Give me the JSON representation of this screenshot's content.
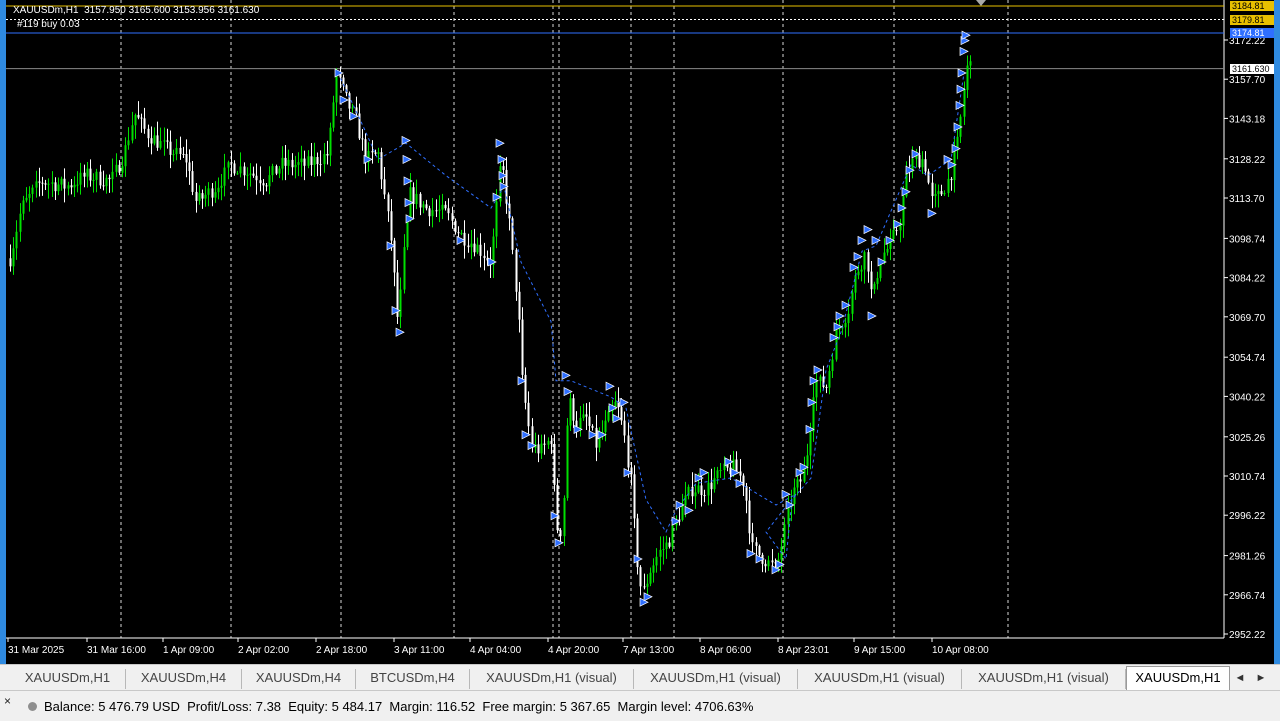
{
  "chart": {
    "header_line": "XAUUSDm,H1  3157.950 3165.600 3153.956 3161.630",
    "order_line": "#119 buy 0.03",
    "price_labels": [
      {
        "text": "3184.81",
        "price": 3184.81,
        "bg": "#e8c000",
        "fg": "#000000"
      },
      {
        "text": "3179.81",
        "price": 3179.81,
        "bg": "#e8c000",
        "fg": "#000000"
      },
      {
        "text": "3174.81",
        "price": 3174.81,
        "bg": "#2f6fff",
        "fg": "#ffffff"
      },
      {
        "text": "3161.630",
        "price": 3161.63,
        "bg": "#ffffff",
        "fg": "#000000"
      }
    ],
    "price_ticks": [
      "3172.22",
      "3157.70",
      "3143.18",
      "3128.22",
      "3113.70",
      "3098.74",
      "3084.22",
      "3069.70",
      "3054.74",
      "3040.22",
      "3025.26",
      "3010.74",
      "2996.22",
      "2981.26",
      "2966.74",
      "2952.22"
    ],
    "time_ticks": [
      "31 Mar 2025",
      "31 Mar 16:00",
      "1 Apr 09:00",
      "2 Apr 02:00",
      "2 Apr 18:00",
      "3 Apr 11:00",
      "4 Apr 04:00",
      "4 Apr 20:00",
      "7 Apr 13:00",
      "8 Apr 06:00",
      "8 Apr 23:01",
      "9 Apr 15:00",
      "10 Apr 08:00"
    ],
    "colors": {
      "background": "#000000",
      "bull": "#00e000",
      "bear": "#ffffff",
      "grid": "#ffffff",
      "trade": "#2f6fff",
      "tp": "#e8c000"
    }
  },
  "tabs": {
    "items": [
      "XAUUSDm,H1",
      "XAUUSDm,H4",
      "XAUUSDm,H4",
      "BTCUSDm,H4",
      "XAUUSDm,H1 (visual)",
      "XAUUSDm,H1 (visual)",
      "XAUUSDm,H1 (visual)",
      "XAUUSDm,H1 (visual)",
      "XAUUSDm,H1"
    ],
    "active_index": 8,
    "prev_icon": "◄",
    "next_icon": "►"
  },
  "status": {
    "close_icon": "×",
    "text": "Balance: 5 476.79 USD  Profit/Loss: 7.38  Equity: 5 484.17  Margin: 116.52  Free margin: 5 367.65  Margin level: 4706.63%"
  }
}
